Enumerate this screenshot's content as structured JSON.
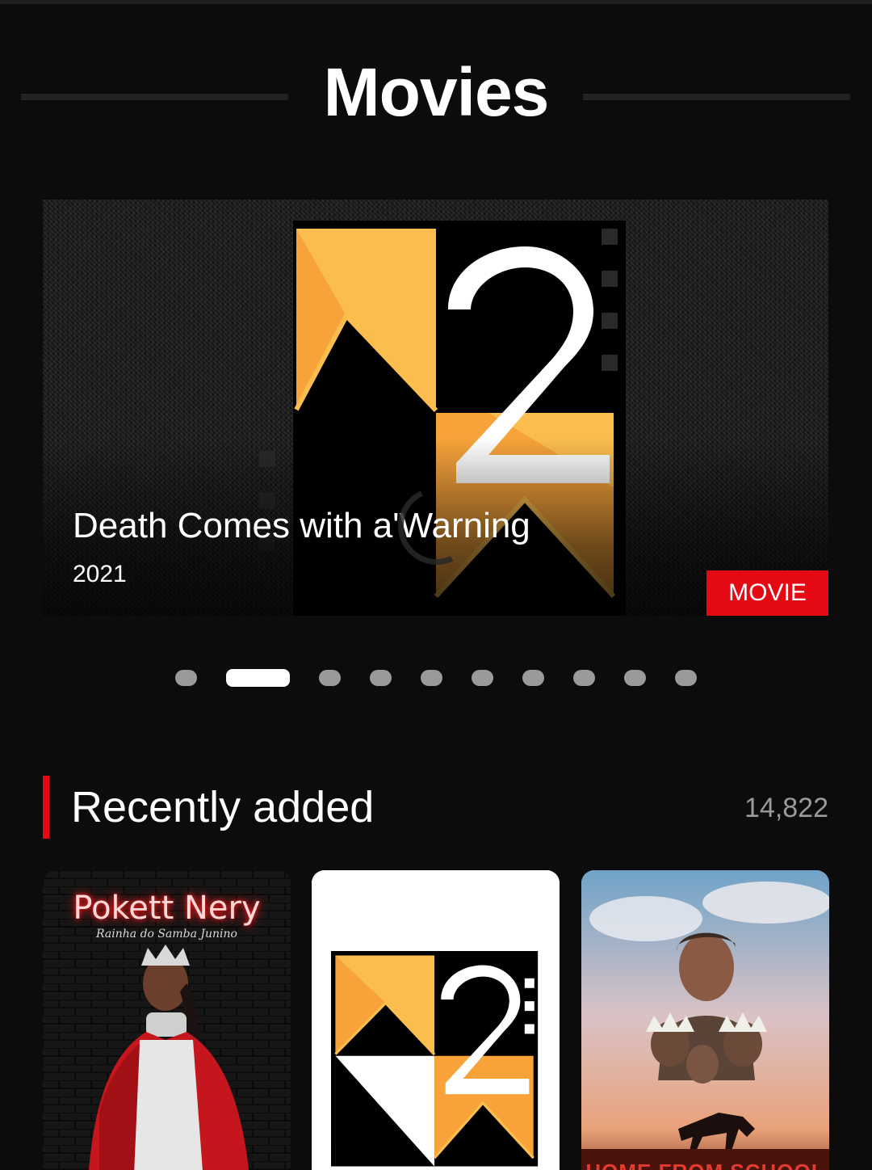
{
  "header": {
    "title": "Movies"
  },
  "hero": {
    "title": "Death Comes with a'Warning",
    "year": "2021",
    "badge": "MOVIE",
    "pager": {
      "count": 10,
      "active_index": 1
    }
  },
  "section": {
    "title": "Recently added",
    "count": "14,822"
  },
  "posters": [
    {
      "title": "Pokett Nery",
      "subtitle": "Rainha do Samba Junino"
    },
    {
      "title": ""
    },
    {
      "title": "HOME FROM SCHOOL"
    }
  ],
  "colors": {
    "background": "#0c0c0c",
    "accent_red": "#e50914",
    "muted_text": "#9a9a9a",
    "logo_orange": "#f7a33a",
    "logo_light_orange": "#fbbd4e"
  }
}
